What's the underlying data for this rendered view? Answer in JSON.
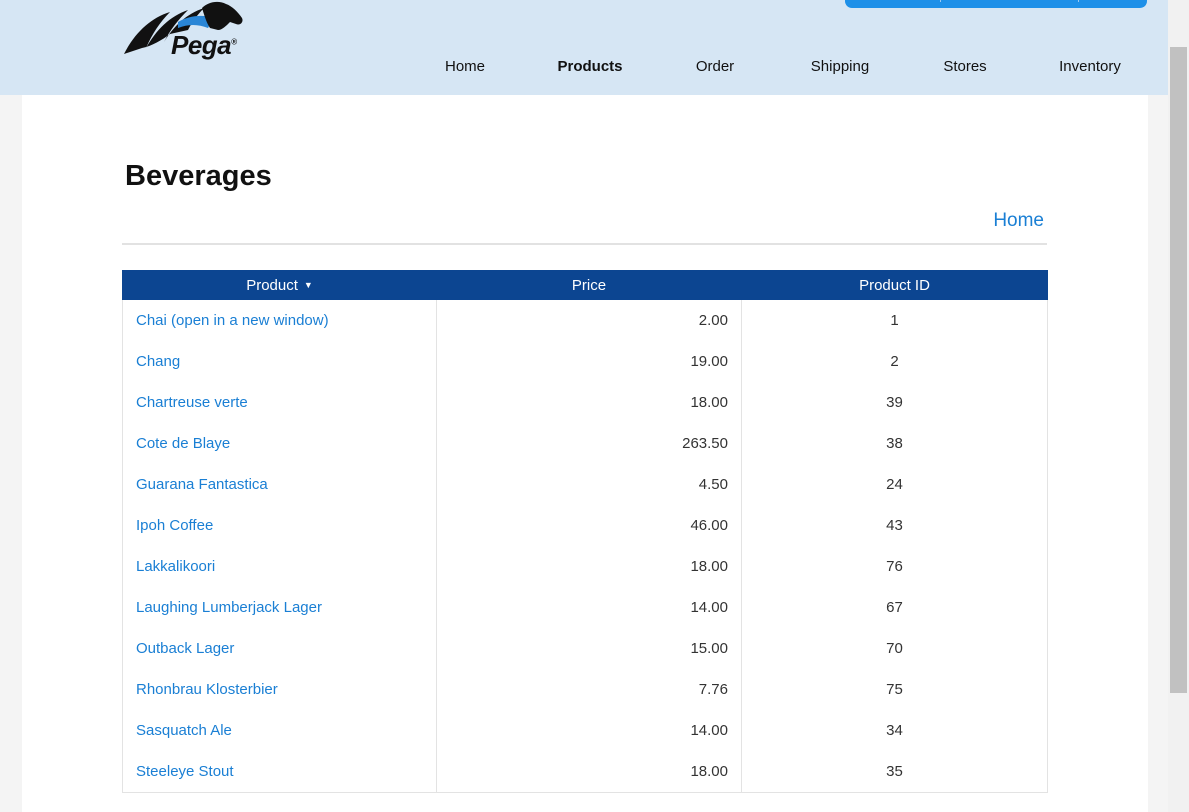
{
  "brand": {
    "logo_text": "Pega",
    "registered_mark": "®"
  },
  "nav": {
    "items": [
      {
        "label": "Home",
        "active": false
      },
      {
        "label": "Products",
        "active": true
      },
      {
        "label": "Order",
        "active": false
      },
      {
        "label": "Shipping",
        "active": false
      },
      {
        "label": "Stores",
        "active": false
      },
      {
        "label": "Inventory",
        "active": false
      }
    ]
  },
  "page": {
    "title": "Beverages",
    "home_link": "Home"
  },
  "table": {
    "columns": [
      "Product",
      "Price",
      "Product ID"
    ],
    "sort_icon": "▼",
    "rows": [
      {
        "name": "Chai  (open in a new window)",
        "price": "2.00",
        "id": "1"
      },
      {
        "name": "Chang",
        "price": "19.00",
        "id": "2"
      },
      {
        "name": "Chartreuse verte",
        "price": "18.00",
        "id": "39"
      },
      {
        "name": "Cote de Blaye",
        "price": "263.50",
        "id": "38"
      },
      {
        "name": "Guarana Fantastica",
        "price": "4.50",
        "id": "24"
      },
      {
        "name": "Ipoh Coffee",
        "price": "46.00",
        "id": "43"
      },
      {
        "name": "Lakkalikoori",
        "price": "18.00",
        "id": "76"
      },
      {
        "name": "Laughing Lumberjack Lager",
        "price": "14.00",
        "id": "67"
      },
      {
        "name": "Outback Lager",
        "price": "15.00",
        "id": "70"
      },
      {
        "name": "Rhonbrau Klosterbier",
        "price": "7.76",
        "id": "75"
      },
      {
        "name": "Sasquatch Ale",
        "price": "14.00",
        "id": "34"
      },
      {
        "name": "Steeleye Stout",
        "price": "18.00",
        "id": "35"
      }
    ]
  },
  "colors": {
    "header_bg": "#d6e6f4",
    "table_header_bg": "#0c4591",
    "link": "#1a7fd4",
    "topbar": "#1e90e8"
  }
}
